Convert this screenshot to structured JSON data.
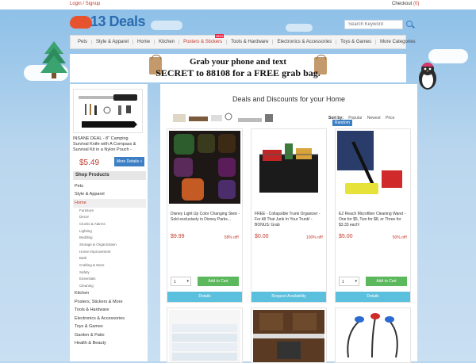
{
  "topbar": {
    "login": "Login / Signup",
    "checkout": "Checkout",
    "cart_count": "(0)"
  },
  "logo": {
    "text": "13 Deals"
  },
  "search": {
    "placeholder": "Search Keyword"
  },
  "nav": [
    {
      "label": "Pets"
    },
    {
      "label": "Style & Apparel"
    },
    {
      "label": "Home"
    },
    {
      "label": "Kitchen"
    },
    {
      "label": "Posters & Stickers",
      "badge": "NEW",
      "active": true
    },
    {
      "label": "Tools & Hardware"
    },
    {
      "label": "Electronics & Accessories"
    },
    {
      "label": "Toys & Games"
    },
    {
      "label": "More Categories"
    }
  ],
  "banner": {
    "line1": "Grab your phone and text",
    "line2": "SECRET to 88108 for a FREE grab bag."
  },
  "sidebar": {
    "featured_title": "INSANE DEAL - 8\" Camping Survival Knife with A Compass & Survival Kit in a Nylon Pouch -",
    "featured_price": "$5.49",
    "more_details": "More Details »",
    "shop_heading": "Shop Products",
    "categories": [
      "Pets",
      "Style & Apparel",
      "Home"
    ],
    "home_sub": [
      "Furniture",
      "Decor",
      "Clocks & Alarms",
      "Lighting",
      "Bedding",
      "Storage & Organization",
      "Home Improvement",
      "Bath",
      "Crafting & More",
      "Safety",
      "Essentials",
      "Cleaning"
    ],
    "categories_after": [
      "Kitchen",
      "Posters, Stickers & More",
      "Tools & Hardware",
      "Electronics & Accessories",
      "Toys & Games",
      "Garden & Patio",
      "Health & Beauty"
    ]
  },
  "main": {
    "title": "Deals and Discounts for your Home",
    "sort_label": "Sort by:",
    "sort_options": [
      "Popular",
      "Newest",
      "Price",
      "Random"
    ],
    "sort_selected": "Random"
  },
  "products": [
    {
      "name": "Disney Light Up Color Changing Stein - Sold exclusively in Disney Parks...",
      "price": "$9.99",
      "off": "58% off!",
      "qty": "1",
      "add": "Add to Cart",
      "details": "Details"
    },
    {
      "name": "FREE - Collapsible Trunk Organizer - For All That Junk In Your Trunk! - BONUS: Grab",
      "price": "$0.00",
      "off": "100% off!",
      "qty": "",
      "add": "",
      "details": "Request Availability"
    },
    {
      "name": "EZ Reach Microfiber Cleaning Wand - One for $5, Two for $8, or Three for $3.33 each!",
      "price": "$5.00",
      "off": "50% off!",
      "qty": "1",
      "add": "Add to Cart",
      "details": "Details"
    }
  ],
  "colors": {
    "accent": "#3d7fc4",
    "price": "#c0392b",
    "add": "#5cb85c",
    "details": "#5bc0de"
  }
}
